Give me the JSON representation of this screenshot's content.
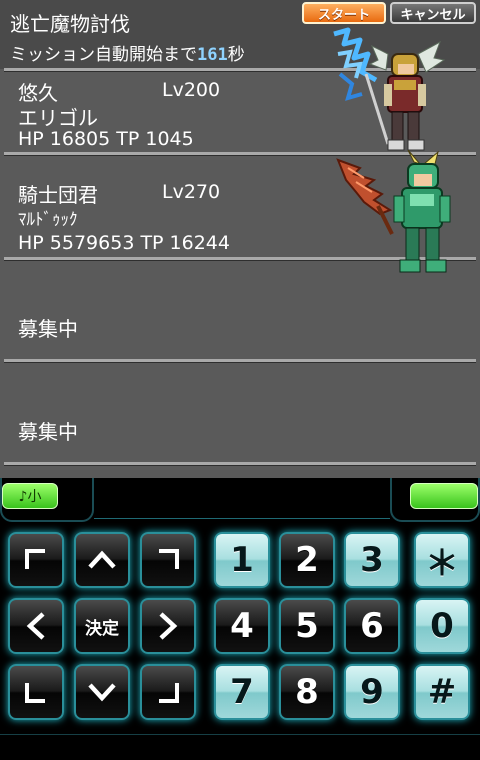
{
  "header": {
    "title": "逃亡魔物討伐",
    "mission_prefix": "ミッション自動開始まで",
    "countdown": "161",
    "mission_suffix": "秒",
    "start_label": "スタート",
    "cancel_label": "キャンセル"
  },
  "party": [
    {
      "name": "悠久",
      "level": "Lv200",
      "job": "エリゴル",
      "stats": "HP 16805  TP 1045"
    },
    {
      "name": "騎士団君",
      "level": "Lv270",
      "job": "ﾏﾙﾄﾞｩｯｸ",
      "stats": "HP 5579653  TP 16244"
    }
  ],
  "recruiting": [
    "募集中",
    "募集中"
  ],
  "softkeys": {
    "left": "♪小",
    "right": ""
  },
  "keypad": {
    "center_label": "決定",
    "digits": [
      "1",
      "2",
      "3",
      "4",
      "5",
      "6",
      "7",
      "8",
      "9",
      "0"
    ],
    "star": "＊",
    "hash": "#"
  },
  "colors": {
    "panel_bg": "#5a5a5a",
    "start_button": "#f07a1a",
    "countdown": "#8fd3ff",
    "key_glow": "#1fb3c2",
    "softkey": "#5ed83a"
  }
}
